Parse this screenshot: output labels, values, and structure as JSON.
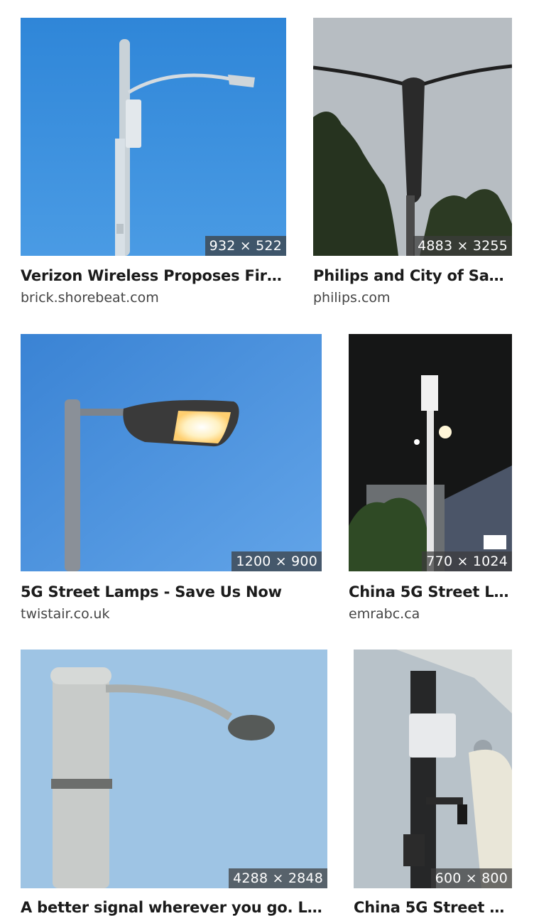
{
  "results": [
    {
      "title": "Verizon Wireless Proposes First ...",
      "source": "brick.shorebeat.com",
      "dimensions": "932 × 522"
    },
    {
      "title": "Philips and City of San J...",
      "source": "philips.com",
      "dimensions": "4883 × 3255"
    },
    {
      "title": "5G Street Lamps - Save Us Now",
      "source": "twistair.co.uk",
      "dimensions": "1200 × 900"
    },
    {
      "title": "China 5G Street Li...",
      "source": "emrabc.ca",
      "dimensions": "770 × 1024"
    },
    {
      "title": "A better signal wherever you go. Los ...",
      "source": "",
      "dimensions": "4288 × 2848"
    },
    {
      "title": "China 5G Street Li...",
      "source": "",
      "dimensions": "600 × 800"
    }
  ]
}
